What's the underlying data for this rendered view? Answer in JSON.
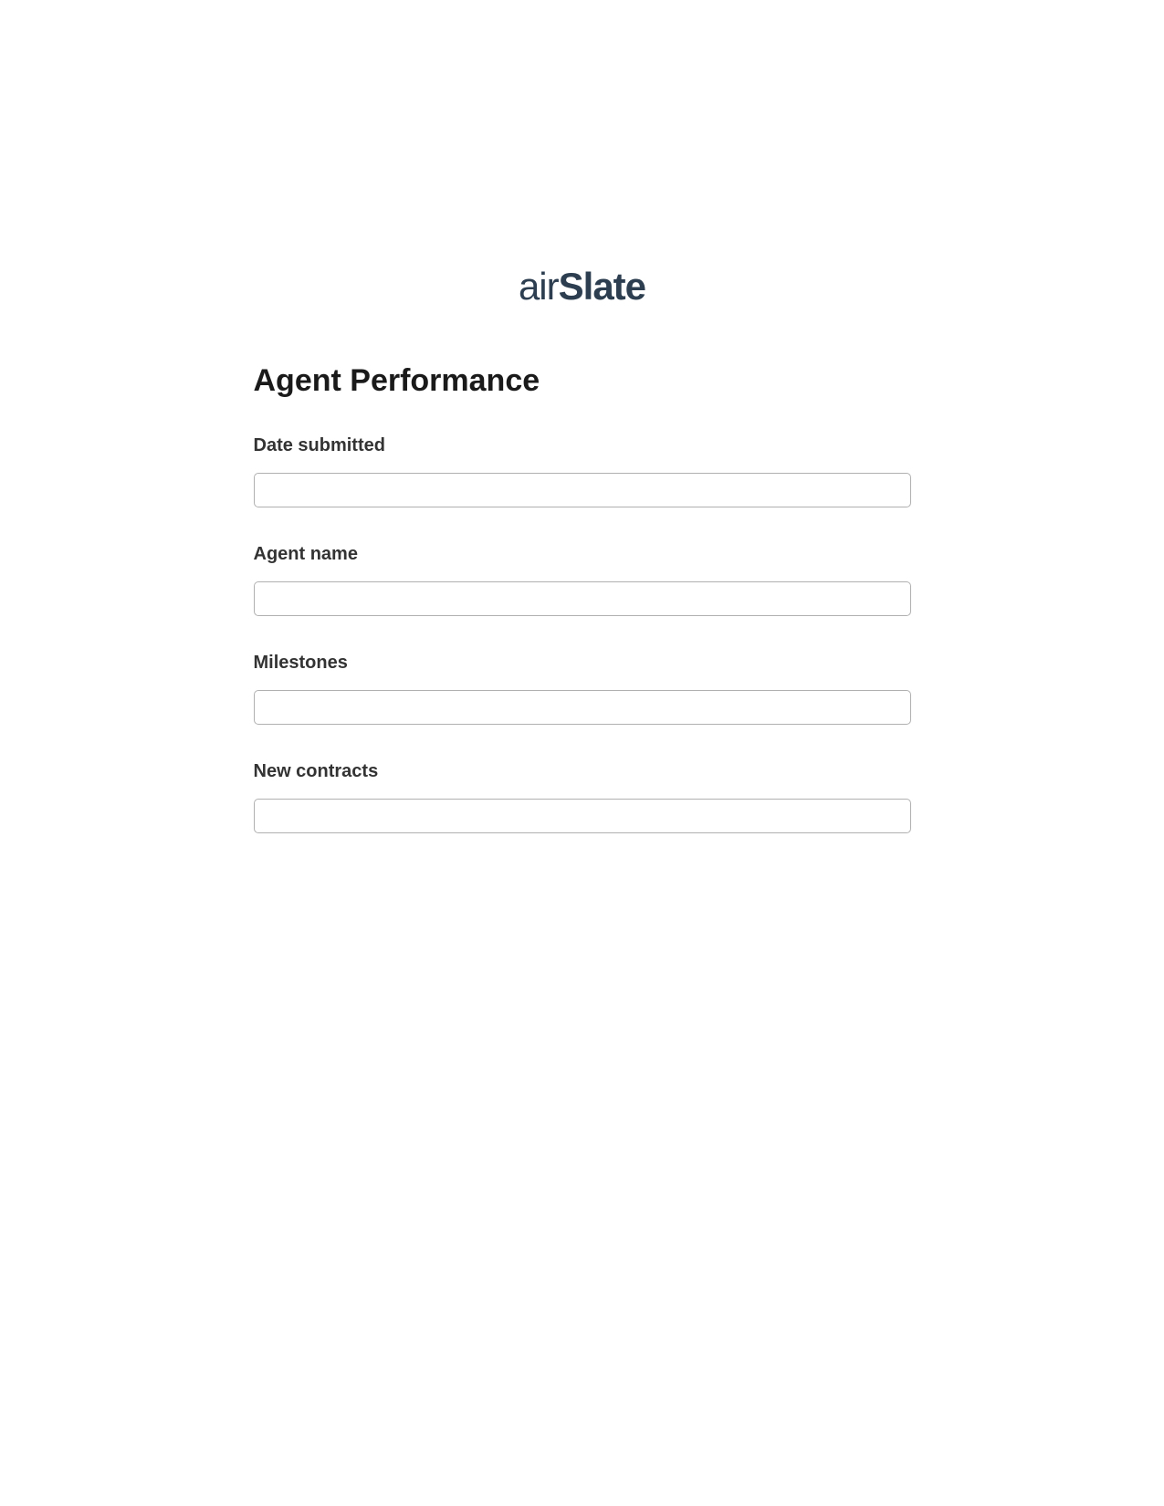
{
  "logo": {
    "prefix": "air",
    "suffix": "Slate"
  },
  "form": {
    "title": "Agent Performance",
    "fields": [
      {
        "label": "Date submitted",
        "value": ""
      },
      {
        "label": "Agent name",
        "value": ""
      },
      {
        "label": "Milestones",
        "value": ""
      },
      {
        "label": "New contracts",
        "value": ""
      }
    ]
  }
}
